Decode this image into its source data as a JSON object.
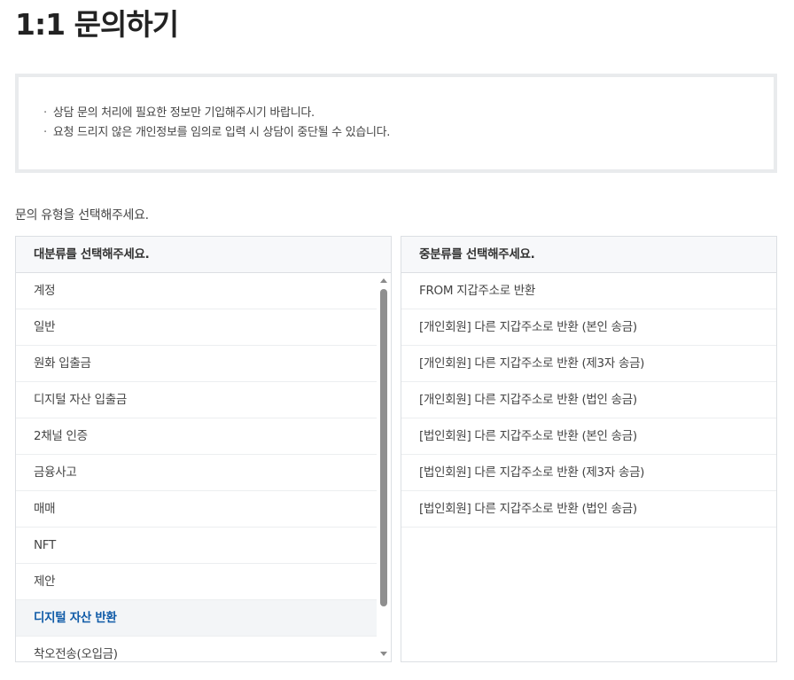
{
  "page": {
    "title": "1:1 문의하기",
    "notices": [
      "상담 문의 처리에 필요한 정보만 기입해주시기 바랍니다.",
      "요청 드리지 않은 개인정보를 임의로 입력 시 상담이 중단될 수 있습니다."
    ],
    "instruction": "문의 유형을 선택해주세요."
  },
  "major_category": {
    "header": "대분류를 선택해주세요.",
    "items": [
      "계정",
      "일반",
      "원화 입출금",
      "디지털 자산 입출금",
      "2채널 인증",
      "금융사고",
      "매매",
      "NFT",
      "제안",
      "디지털 자산 반환",
      "착오전송(오입금)"
    ],
    "selected": "디지털 자산 반환"
  },
  "minor_category": {
    "header": "중분류를 선택해주세요.",
    "items": [
      "FROM 지갑주소로 반환",
      "[개인회원] 다른 지갑주소로 반환 (본인 송금)",
      "[개인회원] 다른 지갑주소로 반환 (제3자 송금)",
      "[개인회원] 다른 지갑주소로 반환 (법인 송금)",
      "[법인회원] 다른 지갑주소로 반환 (본인 송금)",
      "[법인회원] 다른 지갑주소로 반환 (제3자 송금)",
      "[법인회원] 다른 지갑주소로 반환 (법인 송금)"
    ]
  },
  "colors": {
    "selected_text": "#0e5aa7",
    "border": "#dcdfe3"
  }
}
